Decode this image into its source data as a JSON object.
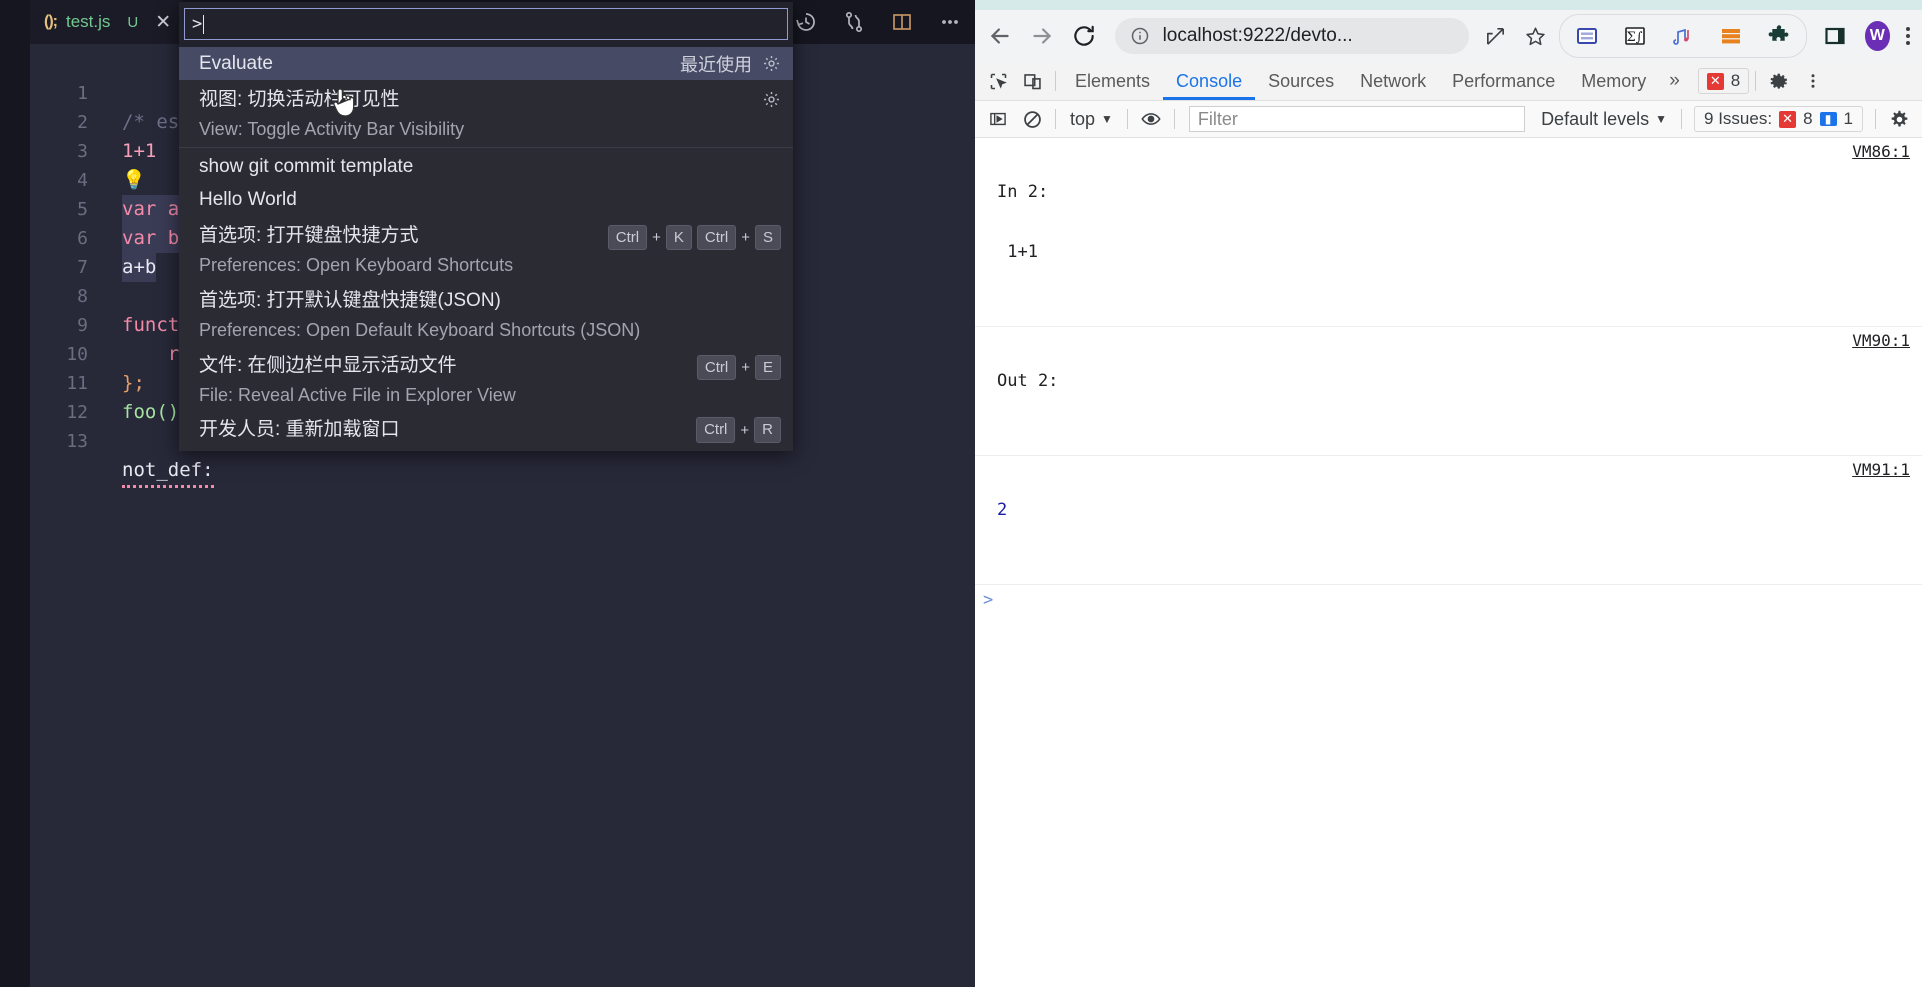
{
  "vscode": {
    "tab": {
      "icon_label": "(); ",
      "filename": "test.js",
      "unsaved_badge": "U",
      "close": "✕"
    },
    "title_actions": [
      {
        "name": "timeline-history-icon",
        "tip": "History"
      },
      {
        "name": "git-compare-icon",
        "tip": "Compare changes"
      },
      {
        "name": "split-editor-icon",
        "tip": "Split editor"
      },
      {
        "name": "more-actions-icon",
        "tip": "More actions"
      }
    ],
    "editor": {
      "lines": [
        {
          "num": "1",
          "text": "/* eslin"
        },
        {
          "num": "2",
          "text": "1+1"
        },
        {
          "num": "3",
          "text": "💡"
        },
        {
          "num": "4",
          "text": "var a = "
        },
        {
          "num": "5",
          "text": "var b = "
        },
        {
          "num": "6",
          "text": "a+b"
        },
        {
          "num": "7",
          "text": ""
        },
        {
          "num": "8",
          "text": "function"
        },
        {
          "num": "9",
          "text": "    retu"
        },
        {
          "num": "10",
          "text": "};"
        },
        {
          "num": "11",
          "text": "foo()"
        },
        {
          "num": "12",
          "text": ""
        },
        {
          "num": "13",
          "text": "not_def:"
        }
      ]
    },
    "palette": {
      "query": ">",
      "placeholder": "",
      "items": [
        {
          "label": "Evaluate",
          "sub": "",
          "right_label": "最近使用",
          "gear": true,
          "keys": [],
          "selected": true
        },
        {
          "label": "视图: 切换活动栏可见性",
          "sub": "View: Toggle Activity Bar Visibility",
          "right_label": "",
          "gear": true,
          "keys": [],
          "selected": false
        },
        {
          "label": "show git commit template",
          "sub": "",
          "right_label": "",
          "gear": false,
          "keys": [],
          "selected": false
        },
        {
          "label": "Hello World",
          "sub": "",
          "right_label": "",
          "gear": false,
          "keys": [],
          "selected": false
        },
        {
          "label": "首选项: 打开键盘快捷方式",
          "sub": "Preferences: Open Keyboard Shortcuts",
          "right_label": "",
          "gear": false,
          "keys": [
            "Ctrl",
            "+",
            "K",
            "Ctrl",
            "+",
            "S"
          ],
          "selected": false
        },
        {
          "label": "首选项: 打开默认键盘快捷键(JSON)",
          "sub": "Preferences: Open Default Keyboard Shortcuts (JSON)",
          "right_label": "",
          "gear": false,
          "keys": [],
          "selected": false
        },
        {
          "label": "文件: 在侧边栏中显示活动文件",
          "sub": "File: Reveal Active File in Explorer View",
          "right_label": "",
          "gear": false,
          "keys": [
            "Ctrl",
            "+",
            "E"
          ],
          "selected": false
        },
        {
          "label": "开发人员: 重新加载窗口",
          "sub": "",
          "right_label": "",
          "gear": false,
          "keys": [
            "Ctrl",
            "+",
            "R"
          ],
          "selected": false
        }
      ]
    }
  },
  "browser": {
    "nav": {
      "back": "←",
      "forward": "→",
      "reload": "⟳"
    },
    "omnibox": {
      "security_icon": "info-circle",
      "url": "localhost:9222/devto..."
    },
    "omnibox_actions": [
      {
        "name": "share-icon"
      },
      {
        "name": "bookmark-star-icon"
      }
    ],
    "extensions": [
      {
        "name": "reading-list-icon"
      },
      {
        "name": "formula-extension-icon"
      },
      {
        "name": "music-extension-icon"
      },
      {
        "name": "orange-list-extension-icon"
      },
      {
        "name": "puzzle-extensions-icon"
      }
    ],
    "side_panel_icon": "side-panel-icon",
    "profile": {
      "initial": "W"
    },
    "menu_icon": "kebab-menu-icon"
  },
  "devtools": {
    "left_icons": [
      {
        "name": "inspect-element-icon"
      },
      {
        "name": "device-toolbar-icon"
      }
    ],
    "tabs": [
      {
        "label": "Elements",
        "active": false
      },
      {
        "label": "Console",
        "active": true
      },
      {
        "label": "Sources",
        "active": false
      },
      {
        "label": "Network",
        "active": false
      },
      {
        "label": "Performance",
        "active": false
      },
      {
        "label": "Memory",
        "active": false
      }
    ],
    "more_tabs": "»",
    "error_chip": {
      "icon": "✕",
      "count": "8"
    },
    "settings_icon": "gear-icon",
    "dots_icon": "kebab-menu-icon",
    "console_bar": {
      "sidebar_toggle": "console-sidebar-icon",
      "clear_icon": "clear-console-icon",
      "context": "top",
      "context_caret": "▼",
      "eye_icon": "live-expression-icon",
      "filter_placeholder": "Filter",
      "levels": "Default levels",
      "levels_caret": "▼",
      "issues": {
        "text": "9 Issues:",
        "errors": "8",
        "infos": "1"
      },
      "settings_icon": "gear-icon"
    },
    "log": [
      {
        "kind": "input",
        "lines": [
          "In 2:",
          " 1+1"
        ],
        "source": "VM86:1"
      },
      {
        "kind": "output-label",
        "lines": [
          "Out 2:"
        ],
        "source": "VM90:1"
      },
      {
        "kind": "value",
        "lines": [
          "2"
        ],
        "source": "VM91:1"
      }
    ],
    "prompt": {
      "arrow": ">",
      "value": ""
    }
  }
}
